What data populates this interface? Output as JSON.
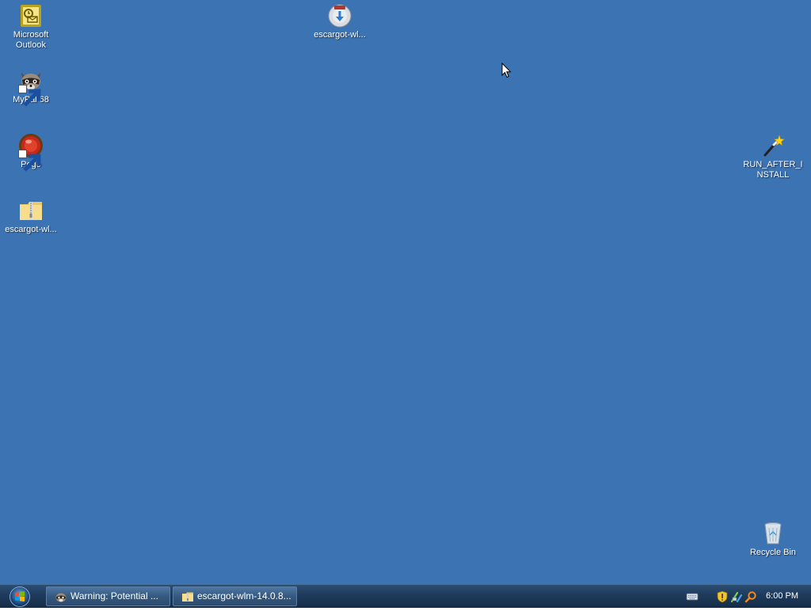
{
  "desktop": {
    "background_color": "#3b73b3",
    "icons": {
      "outlook": {
        "label": "Microsoft Outlook",
        "icon": "outlook-icon"
      },
      "mypal": {
        "label": "MyPal 68",
        "icon": "raccoon-icon"
      },
      "pego": {
        "label": "Pego",
        "icon": "red-orb-icon"
      },
      "escargot_zip": {
        "label": "escargot-wl...",
        "icon": "zip-folder-icon"
      },
      "escargot_installer": {
        "label": "escargot-wl...",
        "icon": "installer-disc-icon"
      },
      "run_after_install": {
        "label": "RUN_AFTER_INSTALL",
        "icon": "magic-wand-icon"
      },
      "recycle_bin": {
        "label": "Recycle Bin",
        "icon": "recycle-bin-icon"
      }
    }
  },
  "taskbar": {
    "start_icon": "windows-logo-icon",
    "tasks": [
      {
        "label": "Warning: Potential ...",
        "icon": "raccoon-icon"
      },
      {
        "label": "escargot-wlm-14.0.8...",
        "icon": "zip-folder-icon"
      }
    ],
    "tray_icons": [
      "keyboard-icon",
      "shield-icon",
      "network-icon",
      "search-icon"
    ],
    "clock": "6:00 PM"
  }
}
